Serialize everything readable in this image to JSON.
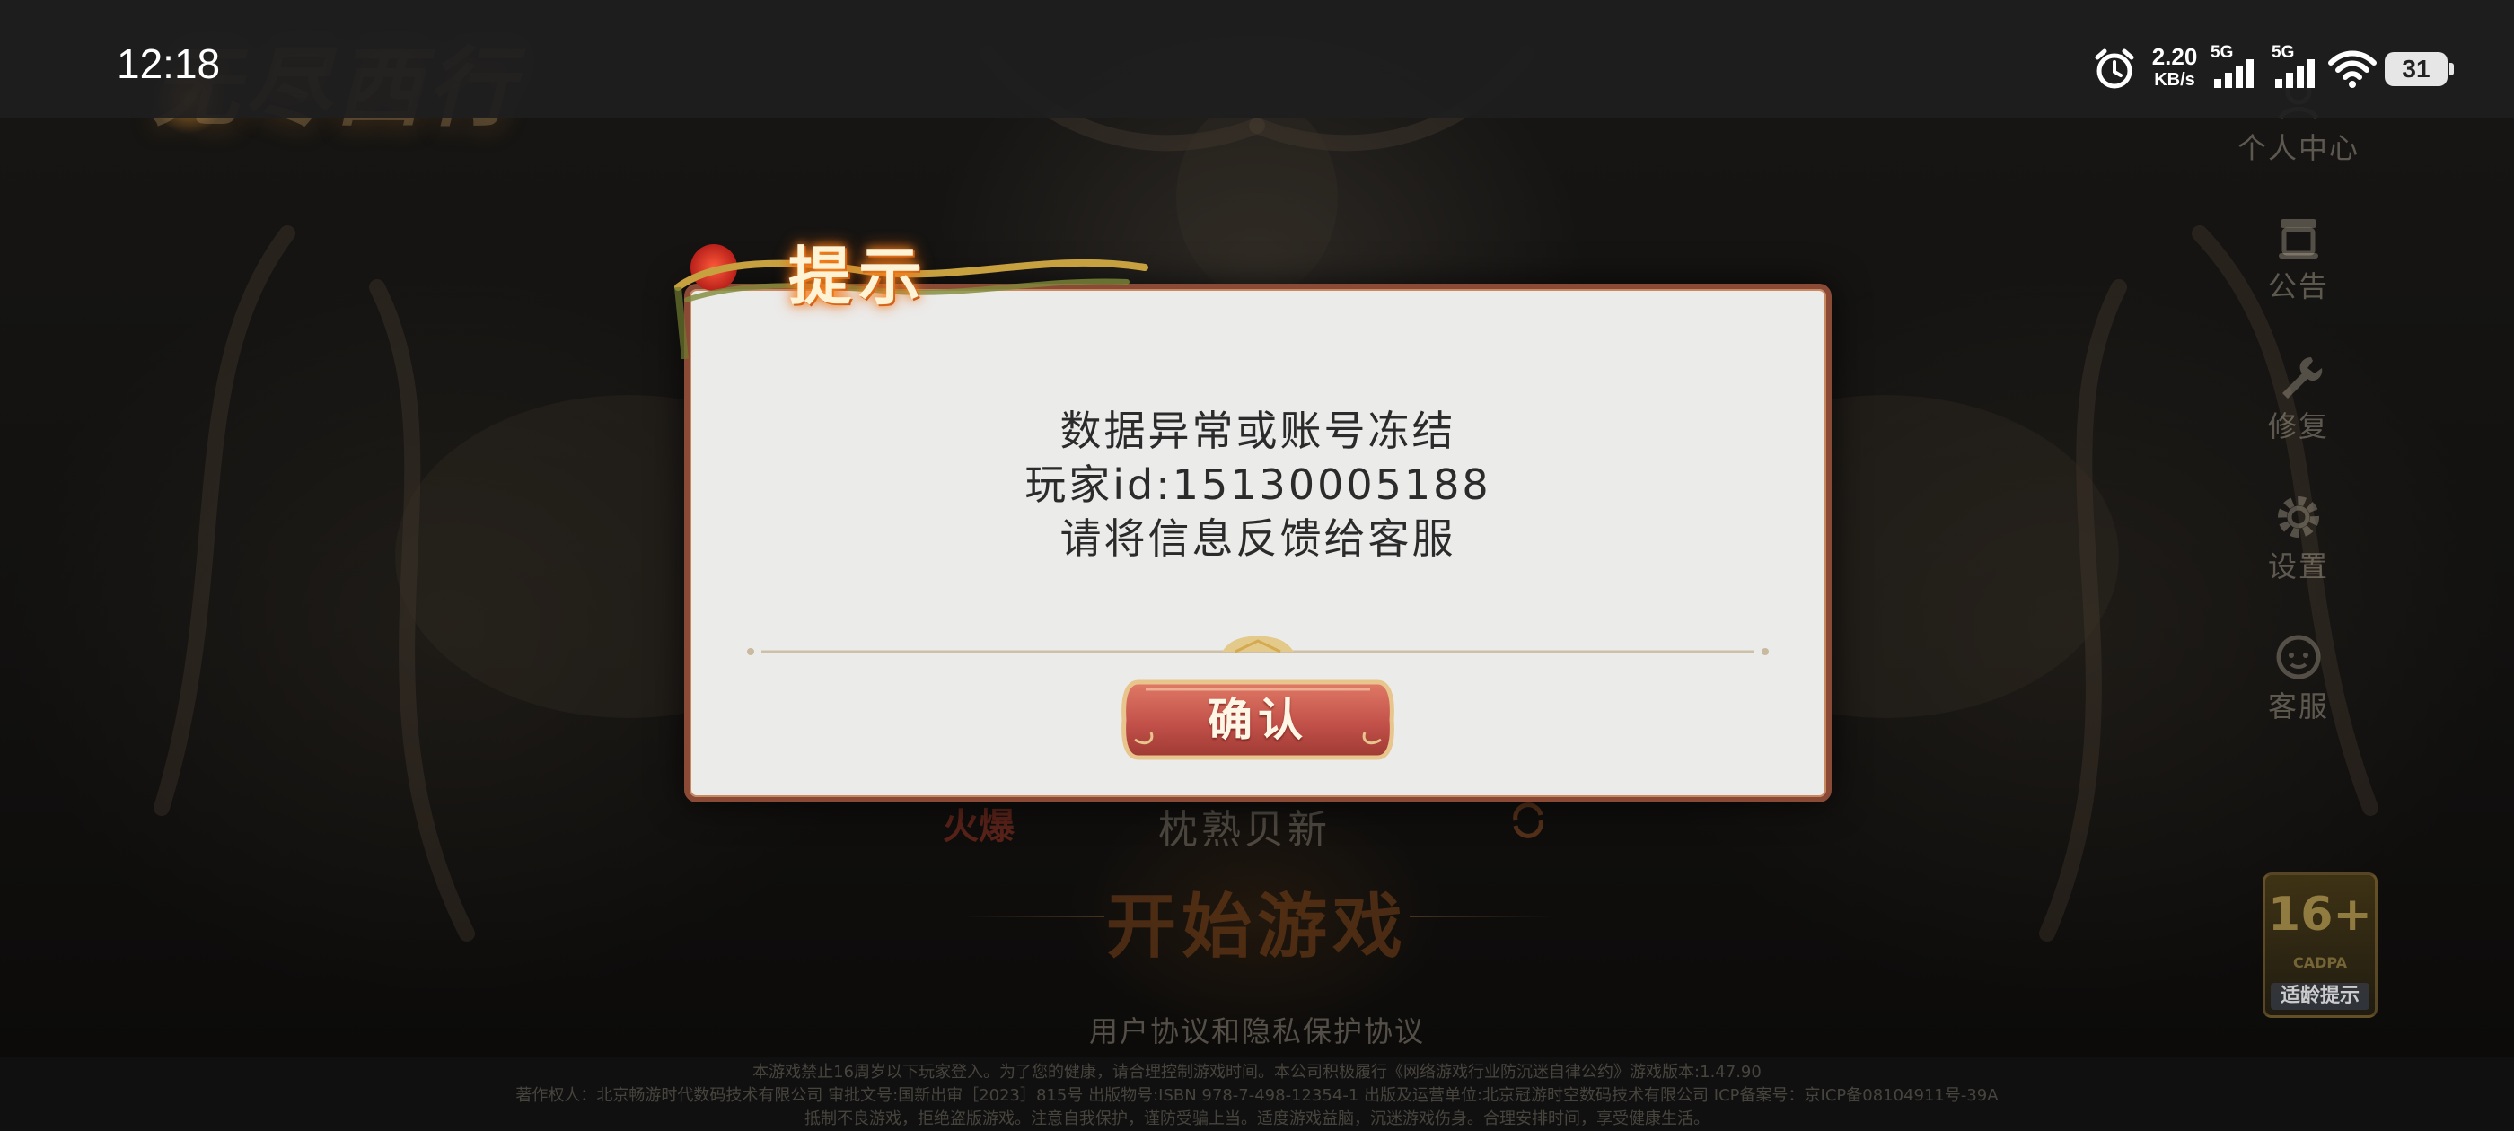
{
  "status_bar": {
    "time": "12:18",
    "net_speed_value": "2.20",
    "net_speed_unit": "KB/s",
    "sim1_label": "5G",
    "sim2_label": "5G",
    "battery_level": "31"
  },
  "background": {
    "logo_text": "无尽西行"
  },
  "side_menu": {
    "items": [
      {
        "label": "个人中心",
        "icon": "user-icon"
      },
      {
        "label": "公告",
        "icon": "notice-icon"
      },
      {
        "label": "修复",
        "icon": "repair-icon"
      },
      {
        "label": "设置",
        "icon": "gear-icon"
      },
      {
        "label": "客服",
        "icon": "support-icon"
      }
    ]
  },
  "server": {
    "tag": "火爆",
    "name": "枕熟贝新"
  },
  "start_button": "开始游戏",
  "agreement_link": "用户协议和隐私保护协议",
  "age_rating": {
    "value": "16+",
    "org": "CADPA",
    "label": "适龄提示"
  },
  "footer": {
    "line1": "本游戏禁止16周岁以下玩家登入。为了您的健康，请合理控制游戏时间。本公司积极履行《网络游戏行业防沉迷自律公约》游戏版本:1.47.90",
    "line2": "著作权人：北京畅游时代数码技术有限公司 审批文号:国新出审［2023］815号 出版物号:ISBN 978-7-498-12354-1 出版及运营单位:北京冠游时空数码技术有限公司 ICP备案号：京ICP备08104911号-39A",
    "line3": "抵制不良游戏，拒绝盗版游戏。注意自我保护，谨防受骗上当。适度游戏益脑，沉迷游戏伤身。合理安排时间，享受健康生活。"
  },
  "dialog": {
    "title": "提示",
    "message_lines": [
      "数据异常或账号冻结",
      "玩家id:15130005188",
      "请将信息反馈给客服"
    ],
    "confirm_label": "确认"
  },
  "colors": {
    "dialog_bg": "#ebebea",
    "dialog_border": "#8a4a35",
    "confirm_button": "#c2514a",
    "title_glow": "#ff8a1e"
  }
}
